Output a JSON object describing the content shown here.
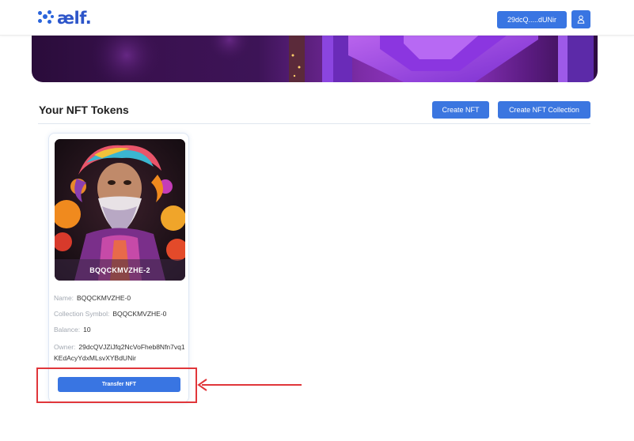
{
  "header": {
    "logo_text": "ælf.",
    "wallet_label": "29dcQ.....dUNir",
    "brand_color": "#3975e2",
    "user_icon": "user-icon"
  },
  "main": {
    "title": "Your NFT Tokens",
    "create_nft_label": "Create NFT",
    "create_collection_label": "Create NFT Collection"
  },
  "nft_card": {
    "image_caption": "BQQCKMVZHE-2",
    "name_label": "Name:",
    "name_value": "BQQCKMVZHE-0",
    "collection_label": "Collection Symbol:",
    "collection_value": "BQQCKMVZHE-0",
    "balance_label": "Balance:",
    "balance_value": "10",
    "owner_label": "Owner:",
    "owner_value": "29dcQVJZiJfq2NcVoFheb8Nfn7vq1KEdAcyYdxMLsvXYBdUNir",
    "transfer_label": "Transfer NFT"
  },
  "annotation": {
    "highlight_color": "#e0363a"
  }
}
